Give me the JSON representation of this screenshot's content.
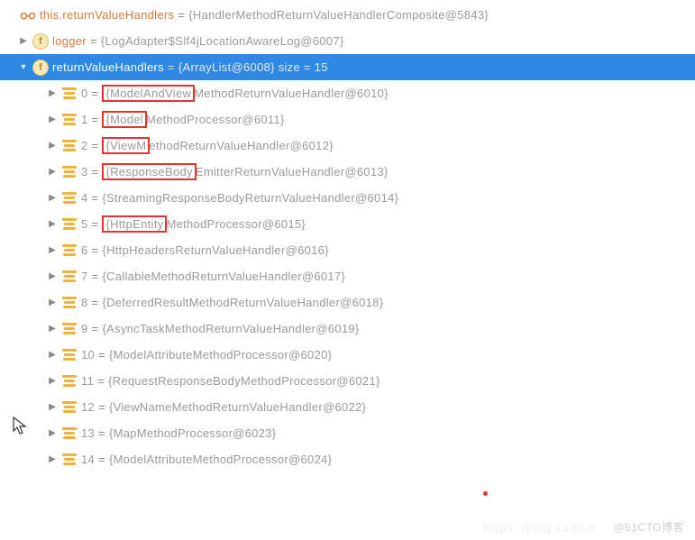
{
  "root": {
    "this_label": "this.",
    "name": "returnValueHandlers",
    "eq": " = ",
    "value": "{HandlerMethodReturnValueHandlerComposite@5843}"
  },
  "logger": {
    "name": "logger",
    "eq": " = ",
    "value": "{LogAdapter$Slf4jLocationAwareLog@6007}"
  },
  "handlers": {
    "name": "returnValueHandlers",
    "eq": " = ",
    "value": "{ArrayList@6008}  size = 15"
  },
  "items": [
    {
      "idx": "0",
      "eq": " = ",
      "boxed": "{ModelAndView",
      "rest": "MethodReturnValueHandler@6010}"
    },
    {
      "idx": "1",
      "eq": " = ",
      "boxed": "{Model",
      "rest": "MethodProcessor@6011}"
    },
    {
      "idx": "2",
      "eq": " = ",
      "boxed": "{ViewM",
      "rest": "ethodReturnValueHandler@6012}"
    },
    {
      "idx": "3",
      "eq": " = ",
      "boxed": "{ResponseBody",
      "rest": "EmitterReturnValueHandler@6013}"
    },
    {
      "idx": "4",
      "eq": " = ",
      "plain": "{StreamingResponseBodyReturnValueHandler@6014}"
    },
    {
      "idx": "5",
      "eq": " = ",
      "boxed": "{HttpEntity",
      "rest": "MethodProcessor@6015}"
    },
    {
      "idx": "6",
      "eq": " = ",
      "plain": "{HttpHeadersReturnValueHandler@6016}"
    },
    {
      "idx": "7",
      "eq": " = ",
      "plain": "{CallableMethodReturnValueHandler@6017}"
    },
    {
      "idx": "8",
      "eq": " = ",
      "plain": "{DeferredResultMethodReturnValueHandler@6018}"
    },
    {
      "idx": "9",
      "eq": " = ",
      "plain": "{AsyncTaskMethodReturnValueHandler@6019}"
    },
    {
      "idx": "10",
      "eq": " = ",
      "plain": "{ModelAttributeMethodProcessor@6020}"
    },
    {
      "idx": "11",
      "eq": " = ",
      "plain": "{RequestResponseBodyMethodProcessor@6021}"
    },
    {
      "idx": "12",
      "eq": " = ",
      "plain": "{ViewNameMethodReturnValueHandler@6022}"
    },
    {
      "idx": "13",
      "eq": " = ",
      "plain": "{MapMethodProcessor@6023}"
    },
    {
      "idx": "14",
      "eq": " = ",
      "plain": "{ModelAttributeMethodProcessor@6024}"
    }
  ],
  "watermark": "@51CTO博客",
  "watermark2": "https://blog.csdn.n"
}
